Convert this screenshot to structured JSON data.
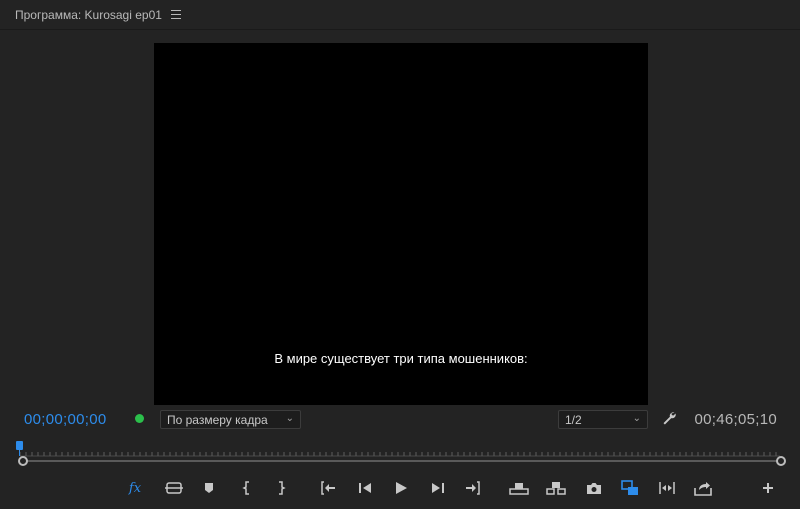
{
  "header": {
    "title": "Программа: Kurosagi ep01",
    "menu_icon": "hamburger-icon"
  },
  "viewer": {
    "subtitle": "В мире существует три типа мошенников:"
  },
  "status": {
    "current_timecode": "00;00;00;00",
    "duration_timecode": "00;46;05;10",
    "zoom_select": {
      "value": "По размеру кадра"
    },
    "resolution_select": {
      "value": "1/2"
    }
  },
  "colors": {
    "accent": "#2d8ceb",
    "background": "#232323",
    "viewer": "#000000",
    "indicator": "#2bbf4b"
  },
  "controls": [
    "fx-icon",
    "overlay-icon",
    "marker-icon",
    "mark-in-icon",
    "mark-out-icon",
    "go-to-in-icon",
    "step-back-icon",
    "play-icon",
    "step-forward-icon",
    "go-to-out-icon",
    "lift-icon",
    "extract-icon",
    "camera-icon",
    "compare-icon",
    "trim-icon",
    "export-icon",
    "add-icon"
  ]
}
